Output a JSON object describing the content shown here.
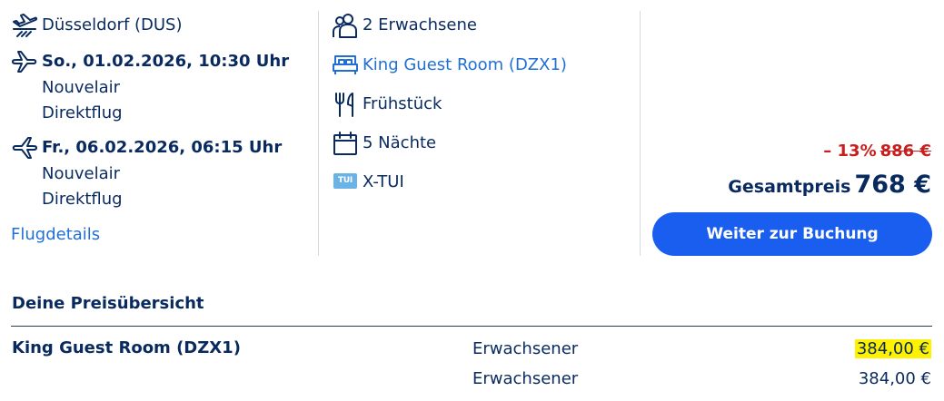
{
  "flight": {
    "origin": "Düsseldorf (DUS)",
    "outbound": {
      "datetime": "So., 01.02.2026, 10:30 Uhr",
      "airline": "Nouvelair",
      "type": "Direktflug"
    },
    "return": {
      "datetime": "Fr., 06.02.2026, 06:15 Uhr",
      "airline": "Nouvelair",
      "type": "Direktflug"
    },
    "details_link": "Flugdetails"
  },
  "stay": {
    "travellers": "2 Erwachsene",
    "room": "King Guest Room (DZX1)",
    "board": "Frühstück",
    "nights": "5 Nächte",
    "operator_badge": "TUI",
    "operator": "X-TUI"
  },
  "pricing": {
    "discount": "– 13%",
    "old_price": "886 €",
    "total_label": "Gesamtpreis",
    "total_value": "768 €",
    "cta": "Weiter zur Buchung"
  },
  "overview": {
    "title": "Deine Preisübersicht",
    "room_name": "King Guest Room (DZX1)",
    "rows": [
      {
        "label": "Erwachsener",
        "amount": "384,00 €",
        "highlighted": true
      },
      {
        "label": "Erwachsener",
        "amount": "384,00 €",
        "highlighted": false
      }
    ]
  },
  "colors": {
    "text": "#092a5e",
    "link": "#1f6fd6",
    "discount": "#c81e1e",
    "button": "#1a5ef0",
    "highlight": "#fff200"
  },
  "icons": [
    "plane-airport-icon",
    "plane-departure-icon",
    "plane-return-icon",
    "people-icon",
    "bed-icon",
    "cutlery-icon",
    "calendar-icon",
    "tui-logo-icon"
  ]
}
